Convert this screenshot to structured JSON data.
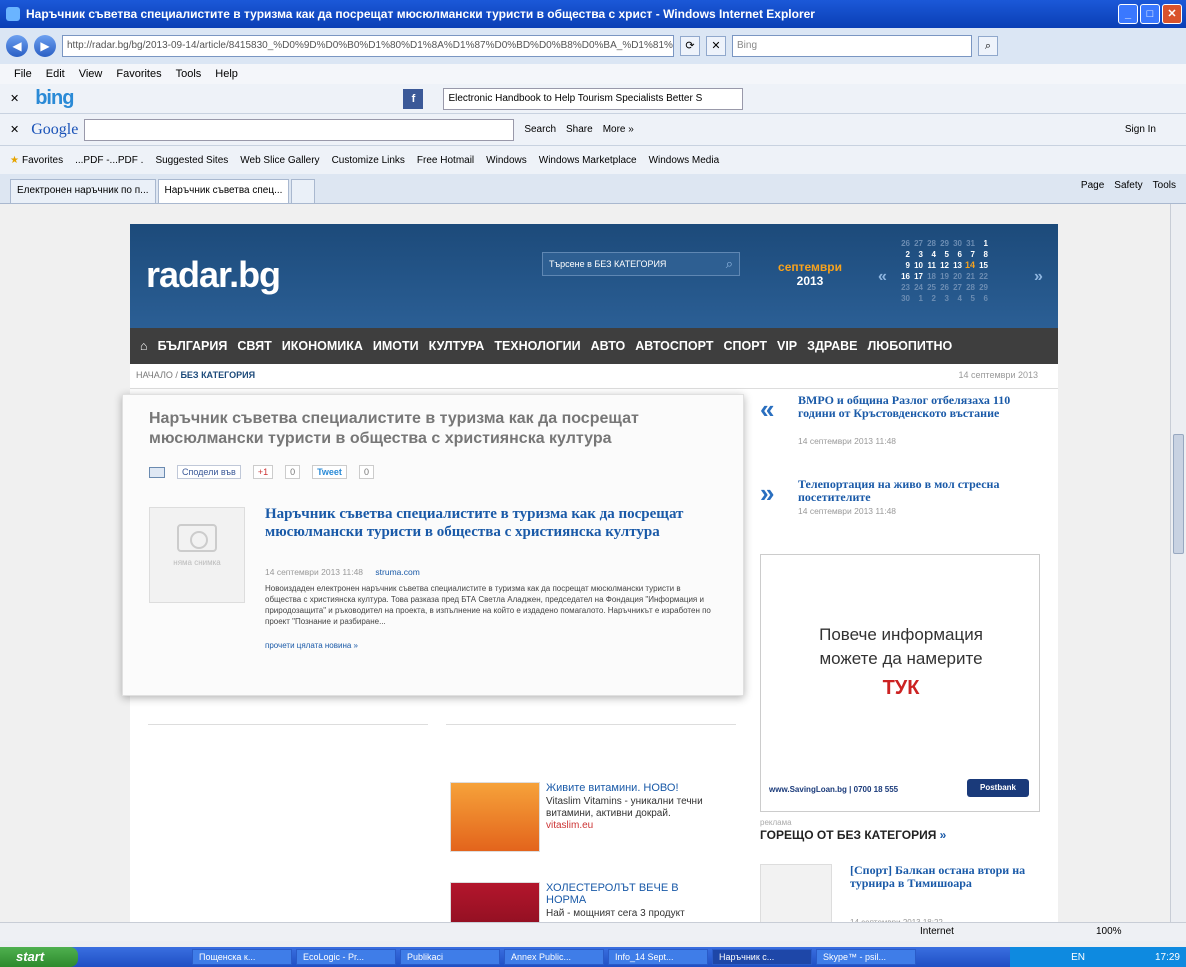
{
  "window": {
    "title": "Наръчник съветва специалистите в туризма как да посрещат мюсюлмански туристи в общества с христ - Windows Internet Explorer"
  },
  "address": {
    "url": "http://radar.bg/bg/2013-09-14/article/8415830_%D0%9D%D0%B0%D1%80%D1%8A%D1%87%D0%BD%D0%B8%D0%BA_%D1%81%D1%8A%D0%B2%D0%B5",
    "search_placeholder": "Bing"
  },
  "menu": [
    "File",
    "Edit",
    "View",
    "Favorites",
    "Tools",
    "Help"
  ],
  "bing": {
    "logo": "bing",
    "search_value": "Electronic Handbook to Help Tourism Specialists Better S"
  },
  "google": {
    "logo": "Google",
    "search": "Search",
    "share": "Share",
    "more": "More »",
    "signin": "Sign In"
  },
  "favorites": {
    "label": "Favorites",
    "items": [
      "...PDF -...PDF .",
      "Suggested Sites",
      "Web Slice Gallery",
      "Customize Links",
      "Free Hotmail",
      "Windows",
      "Windows Marketplace",
      "Windows Media"
    ]
  },
  "tabs": [
    "Електронен наръчник по п...",
    "Наръчник съветва спец..."
  ],
  "tabtools": [
    "Page",
    "Safety",
    "Tools"
  ],
  "site": {
    "logo": "radar.bg",
    "search_placeholder": "Търсене в БЕЗ КАТЕГОРИЯ",
    "month": "септември",
    "year": "2013",
    "calendar": [
      [
        "26",
        "27",
        "28",
        "29",
        "30",
        "31",
        "1"
      ],
      [
        "2",
        "3",
        "4",
        "5",
        "6",
        "7",
        "8"
      ],
      [
        "9",
        "10",
        "11",
        "12",
        "13",
        "14",
        "15"
      ],
      [
        "16",
        "17",
        "18",
        "19",
        "20",
        "21",
        "22"
      ],
      [
        "23",
        "24",
        "25",
        "26",
        "27",
        "28",
        "29"
      ],
      [
        "30",
        "1",
        "2",
        "3",
        "4",
        "5",
        "6"
      ]
    ],
    "nav": [
      "БЪЛГАРИЯ",
      "СВЯТ",
      "ИКОНОМИКА",
      "ИМОТИ",
      "КУЛТУРА",
      "ТЕХНОЛОГИИ",
      "АВТО",
      "АВТОСПОРТ",
      "СПОРТ",
      "VIP",
      "ЗДРАВЕ",
      "ЛЮБОПИТНО"
    ],
    "breadcrumb": {
      "home": "НАЧАЛО",
      "sep": "/",
      "current": "БЕЗ КАТЕГОРИЯ"
    },
    "date": "14 септември 2013"
  },
  "article": {
    "title": "Наръчник съветва специалистите в туризма как да посрещат мюсюлмански туристи в общества с християнска култура",
    "share_fb": "Сподели във",
    "gplus": "+1",
    "gcount": "0",
    "tweet": "Tweet",
    "tcount": "0",
    "no_photo": "няма снимка",
    "headline": "Наръчник съветва специалистите в туризма как да посрещат мюсюлмански туристи в общества с християнска култура",
    "meta_date": "14 септември 2013 11:48",
    "source": "struma.com",
    "body": "Новоиздаден електронен наръчник съветва специалистите в туризма как да посрещат мюсюлмански туристи в общества с християнска култура. Това разказа пред БТА Светла Аладжен, председател на Фондация \"Информация и природозащита\" и ръководител на проекта, в изпълнение на който е издадено помагалото. Наръчникът е изработен по проект \"Познание и разбиране...",
    "more": "прочети цялата новина »"
  },
  "ads": [
    {
      "title": "Живите витамини. НОВО!",
      "desc": "Vitaslim Vitamins - уникални течни витамини, активни докрай.",
      "url": "vitaslim.eu"
    },
    {
      "title": "ХОЛЕСТЕРОЛЪТ ВЕЧЕ В НОРМА",
      "desc": "Най - мощният сега 3 продукт",
      "url": ""
    }
  ],
  "side_news": [
    {
      "title": "ВМРО и община Разлог отбелязаха 110 години от Кръстовденското въстание",
      "date": "14 септември 2013 11:48"
    },
    {
      "title": "Телепортация на живо в мол стресна посетителите",
      "date": "14 септември 2013 11:48"
    }
  ],
  "banner": {
    "line1": "Повече информация",
    "line2": "можете да намерите",
    "tuk": "ТУК",
    "footer": "www.SavingLoan.bg  |  0700 18 555",
    "brand": "Postbank",
    "label": "реклама"
  },
  "hot": {
    "title": "ГОРЕЩО ОТ БЕЗ КАТЕГОРИЯ",
    "arrow": "»",
    "item_title": "[Спорт] Балкан остана втори на турнира в Тимишоара",
    "item_date": "14 септември 2013 18:22"
  },
  "status": {
    "zone": "Internet",
    "zoom": "100%"
  },
  "taskbar": {
    "start": "start",
    "items": [
      "Пощенска к...",
      "EcoLogic - Pr...",
      "Publikaci",
      "Annex Public...",
      "Info_14 Sept...",
      "Наръчник с...",
      "Skype™ - psil..."
    ],
    "lang": "EN",
    "time": "17:29"
  }
}
